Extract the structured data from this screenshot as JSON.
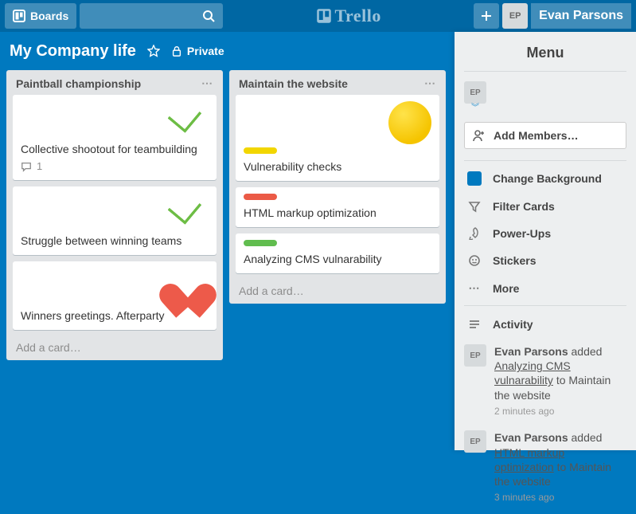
{
  "header": {
    "boards_label": "Boards",
    "logo_text": "Trello",
    "user_initials": "EP",
    "user_name": "Evan Parsons"
  },
  "board": {
    "title": "My Company life",
    "visibility": "Private"
  },
  "lists": [
    {
      "name": "Paintball championship",
      "cards": [
        {
          "title": "Collective shootout for teambuilding",
          "comments": "1",
          "sticker": "check"
        },
        {
          "title": "Struggle between winning teams",
          "sticker": "check"
        },
        {
          "title": "Winners greetings. Afterparty",
          "sticker": "heart"
        }
      ],
      "add_label": "Add a card…"
    },
    {
      "name": "Maintain the website",
      "cards": [
        {
          "title": "Vulnerability checks",
          "label": "yellow",
          "sticker": "smile"
        },
        {
          "title": "HTML markup optimization",
          "label": "red"
        },
        {
          "title": "Analyzing CMS vulnarability",
          "label": "green"
        }
      ],
      "add_label": "Add a card…"
    }
  ],
  "menu": {
    "title": "Menu",
    "member_initials": "EP",
    "add_members_label": "Add Members…",
    "items": {
      "bg": "Change Background",
      "filter": "Filter Cards",
      "powerups": "Power-Ups",
      "stickers": "Stickers",
      "more": "More"
    },
    "activity_label": "Activity",
    "activity": [
      {
        "initials": "EP",
        "user": "Evan Parsons",
        "verb": "added",
        "card": "Analyzing CMS vulnarability",
        "to": "to Maintain the website",
        "time": "2 minutes ago"
      },
      {
        "initials": "EP",
        "user": "Evan Parsons",
        "verb": "added",
        "card": "HTML markup optimization",
        "to": "to Maintain the website",
        "time": "3 minutes ago"
      }
    ]
  }
}
